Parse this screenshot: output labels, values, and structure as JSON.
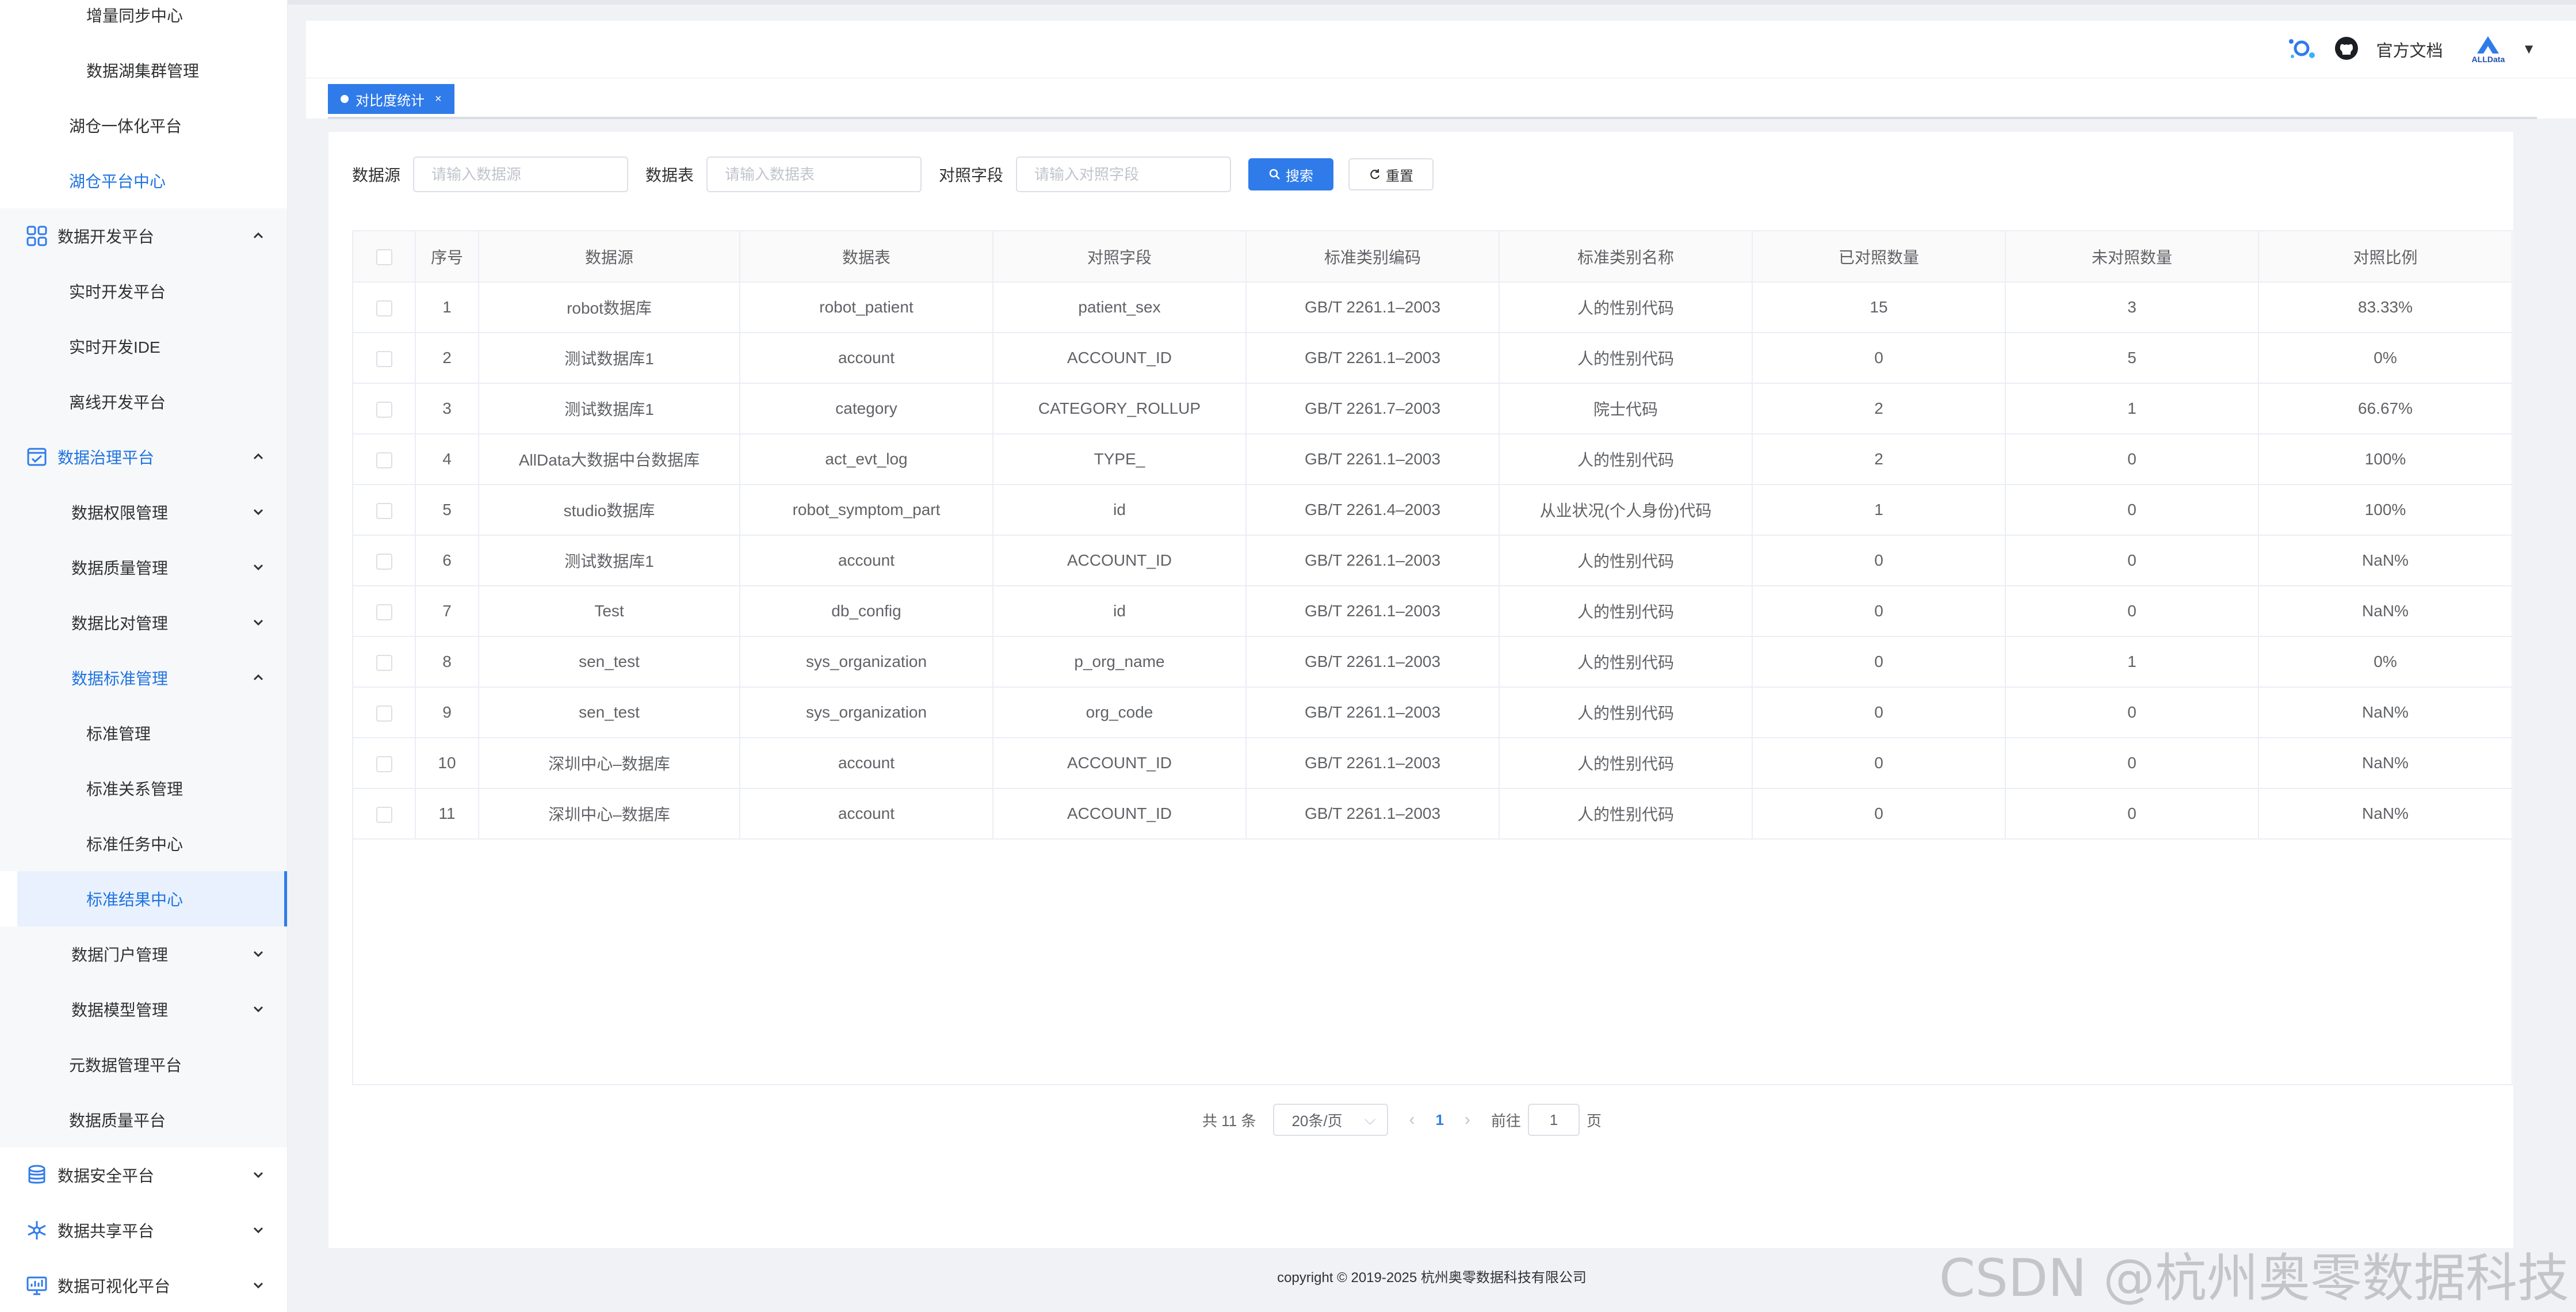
{
  "sidebar": {
    "items": [
      {
        "label": "增量同步中心"
      },
      {
        "label": "数据湖集群管理"
      },
      {
        "label": "湖仓一体化平台"
      },
      {
        "label": "湖仓平台中心"
      },
      {
        "label": "数据开发平台"
      },
      {
        "label": "实时开发平台"
      },
      {
        "label": "实时开发IDE"
      },
      {
        "label": "离线开发平台"
      },
      {
        "label": "数据治理平台"
      },
      {
        "label": "数据权限管理"
      },
      {
        "label": "数据质量管理"
      },
      {
        "label": "数据比对管理"
      },
      {
        "label": "数据标准管理"
      },
      {
        "label": "标准管理"
      },
      {
        "label": "标准关系管理"
      },
      {
        "label": "标准任务中心"
      },
      {
        "label": "标准结果中心"
      },
      {
        "label": "数据门户管理"
      },
      {
        "label": "数据模型管理"
      },
      {
        "label": "元数据管理平台"
      },
      {
        "label": "数据质量平台"
      },
      {
        "label": "数据安全平台"
      },
      {
        "label": "数据共享平台"
      },
      {
        "label": "数据可视化平台"
      }
    ]
  },
  "header": {
    "docs_label": "官方文档",
    "logo_text": "ALLData"
  },
  "tab": {
    "label": "对比度统计",
    "close": "×"
  },
  "search": {
    "datasource_label": "数据源",
    "datasource_placeholder": "请输入数据源",
    "table_label": "数据表",
    "table_placeholder": "请输入数据表",
    "field_label": "对照字段",
    "field_placeholder": "请输入对照字段",
    "search_button": "搜索",
    "reset_button": "重置"
  },
  "table": {
    "columns": [
      "序号",
      "数据源",
      "数据表",
      "对照字段",
      "标准类别编码",
      "标准类别名称",
      "已对照数量",
      "未对照数量",
      "对照比例"
    ],
    "rows": [
      [
        "1",
        "robot数据库",
        "robot_patient",
        "patient_sex",
        "GB/T 2261.1–2003",
        "人的性别代码",
        "15",
        "3",
        "83.33%"
      ],
      [
        "2",
        "测试数据库1",
        "account",
        "ACCOUNT_ID",
        "GB/T 2261.1–2003",
        "人的性别代码",
        "0",
        "5",
        "0%"
      ],
      [
        "3",
        "测试数据库1",
        "category",
        "CATEGORY_ROLLUP",
        "GB/T 2261.7–2003",
        "院士代码",
        "2",
        "1",
        "66.67%"
      ],
      [
        "4",
        "AllData大数据中台数据库",
        "act_evt_log",
        "TYPE_",
        "GB/T 2261.1–2003",
        "人的性别代码",
        "2",
        "0",
        "100%"
      ],
      [
        "5",
        "studio数据库",
        "robot_symptom_part",
        "id",
        "GB/T 2261.4–2003",
        "从业状况(个人身份)代码",
        "1",
        "0",
        "100%"
      ],
      [
        "6",
        "测试数据库1",
        "account",
        "ACCOUNT_ID",
        "GB/T 2261.1–2003",
        "人的性别代码",
        "0",
        "0",
        "NaN%"
      ],
      [
        "7",
        "Test",
        "db_config",
        "id",
        "GB/T 2261.1–2003",
        "人的性别代码",
        "0",
        "0",
        "NaN%"
      ],
      [
        "8",
        "sen_test",
        "sys_organization",
        "p_org_name",
        "GB/T 2261.1–2003",
        "人的性别代码",
        "0",
        "1",
        "0%"
      ],
      [
        "9",
        "sen_test",
        "sys_organization",
        "org_code",
        "GB/T 2261.1–2003",
        "人的性别代码",
        "0",
        "0",
        "NaN%"
      ],
      [
        "10",
        "深圳中心–数据库",
        "account",
        "ACCOUNT_ID",
        "GB/T 2261.1–2003",
        "人的性别代码",
        "0",
        "0",
        "NaN%"
      ],
      [
        "11",
        "深圳中心–数据库",
        "account",
        "ACCOUNT_ID",
        "GB/T 2261.1–2003",
        "人的性别代码",
        "0",
        "0",
        "NaN%"
      ]
    ]
  },
  "pagination": {
    "total": "共 11 条",
    "page_size": "20条/页",
    "current_page": "1",
    "goto_prefix": "前往",
    "goto_value": "1",
    "goto_suffix": "页"
  },
  "footer": {
    "copyright": "copyright © 2019-2025 杭州奥零数据科技有限公司"
  },
  "watermark": "CSDN @杭州奥零数据科技",
  "colors": {
    "accent": "#2f7bea",
    "active_bg": "#e8f1fd"
  }
}
